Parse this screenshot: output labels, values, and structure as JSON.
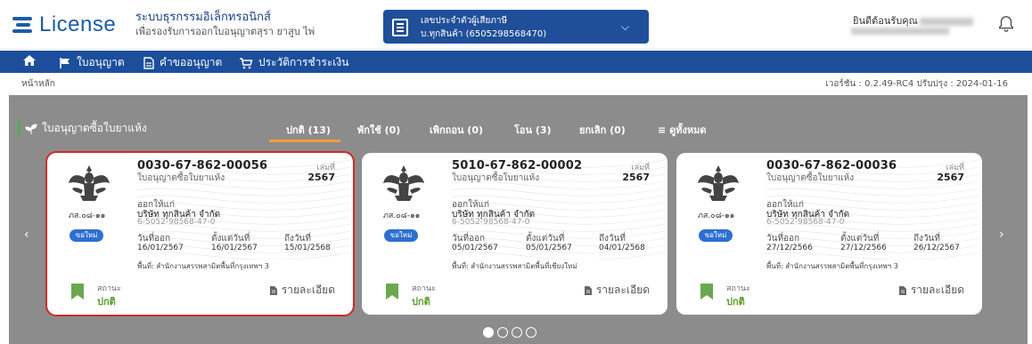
{
  "header": {
    "logo_text": "License",
    "system_title": "ระบบธุรกรรมอิเล็กทรอนิกส์",
    "system_subtitle": "เพื่อรองรับการออกใบอนุญาตสุรา ยาสูบ ไพ่",
    "tax_label": "เลขประจำตัวผู้เสียภาษี",
    "tax_value": "บ.ทุกสินค้า (6505298568470)",
    "welcome": "ยินดีต้อนรับคุณ"
  },
  "nav": {
    "items": [
      {
        "label": "ใบอนุญาต",
        "icon": "flag-icon"
      },
      {
        "label": "คำขออนุญาต",
        "icon": "document-icon"
      },
      {
        "label": "ประวัติการชำระเงิน",
        "icon": "cart-icon"
      }
    ]
  },
  "breadcrumb": {
    "home": "หน้าหลัก",
    "version": "เวอร์ชัน : 0.2.49-RC4 ปรับปรุง : 2024-01-16"
  },
  "section": {
    "title": "ใบอนุญาตซื้อใบยาแห้ง",
    "tabs": [
      {
        "label": "ปกติ (13)",
        "active": true
      },
      {
        "label": "พักใช้ (0)",
        "active": false
      },
      {
        "label": "เพิกถอน (0)",
        "active": false
      },
      {
        "label": "โอน (3)",
        "active": false
      },
      {
        "label": "ยกเลิก (0)",
        "active": false
      },
      {
        "label": "ดูทั้งหมด",
        "active": false
      }
    ]
  },
  "cards": [
    {
      "code": "0030-67-862-00056",
      "type": "ใบอนุญาตซื้อใบยาแห้ง",
      "book_label": "เล่มที่",
      "book_value": "2567",
      "form_code": "ภส.๐๘-๑๑",
      "issued_to_label": "ออกให้แก่",
      "company": "บริษัท ทุกสินค้า จำกัด",
      "tax_id": "6-5052-98568-47-0",
      "badge": "ขอใหม่",
      "issue_label": "วันที่ออก",
      "issue_date": "16/01/2567",
      "start_label": "ตั้งแต่วันที่",
      "start_date": "16/01/2567",
      "end_label": "ถึงวันที่",
      "end_date": "15/01/2568",
      "area": "พื้นที่: สำนักงานสรรพสามิตพื้นที่กรุงเทพฯ 3",
      "status_label": "สถานะ",
      "status_value": "ปกติ",
      "detail_label": "รายละเอียด"
    },
    {
      "code": "5010-67-862-00002",
      "type": "ใบอนุญาตซื้อใบยาแห้ง",
      "book_label": "เล่มที่",
      "book_value": "2567",
      "form_code": "ภส.๐๘-๑๑",
      "issued_to_label": "ออกให้แก่",
      "company": "บริษัท ทุกสินค้า จำกัด",
      "tax_id": "6-5052-98568-47-0",
      "badge": "ขอใหม่",
      "issue_label": "วันที่ออก",
      "issue_date": "05/01/2567",
      "start_label": "ตั้งแต่วันที่",
      "start_date": "05/01/2567",
      "end_label": "ถึงวันที่",
      "end_date": "04/01/2568",
      "area": "พื้นที่: สำนักงานสรรพสามิตพื้นที่เชียงใหม่",
      "status_label": "สถานะ",
      "status_value": "ปกติ",
      "detail_label": "รายละเอียด"
    },
    {
      "code": "0030-67-862-00036",
      "type": "ใบอนุญาตซื้อใบยาแห้ง",
      "book_label": "เล่มที่",
      "book_value": "2567",
      "form_code": "ภส.๐๘-๑๑",
      "issued_to_label": "ออกให้แก่",
      "company": "บริษัท ทุกสินค้า จำกัด",
      "tax_id": "6-5052-98568-47-0",
      "badge": "ขอใหม่",
      "issue_label": "วันที่ออก",
      "issue_date": "27/12/2566",
      "start_label": "ตั้งแต่วันที่",
      "start_date": "27/12/2566",
      "end_label": "ถึงวันที่",
      "end_date": "26/12/2567",
      "area": "พื้นที่: สำนักงานสรรพสามิตพื้นที่กรุงเทพฯ 3",
      "status_label": "สถานะ",
      "status_value": "ปกติ",
      "detail_label": "รายละเอียด"
    }
  ],
  "colors": {
    "brand": "#1c4e9c",
    "status_ok": "#5a9e2a",
    "tab_active_underline": "#f0a030",
    "selection_outline": "#d22a2a",
    "panel_bg": "#8c8c8c"
  },
  "carousel": {
    "pages": 4,
    "active_page": 1
  }
}
